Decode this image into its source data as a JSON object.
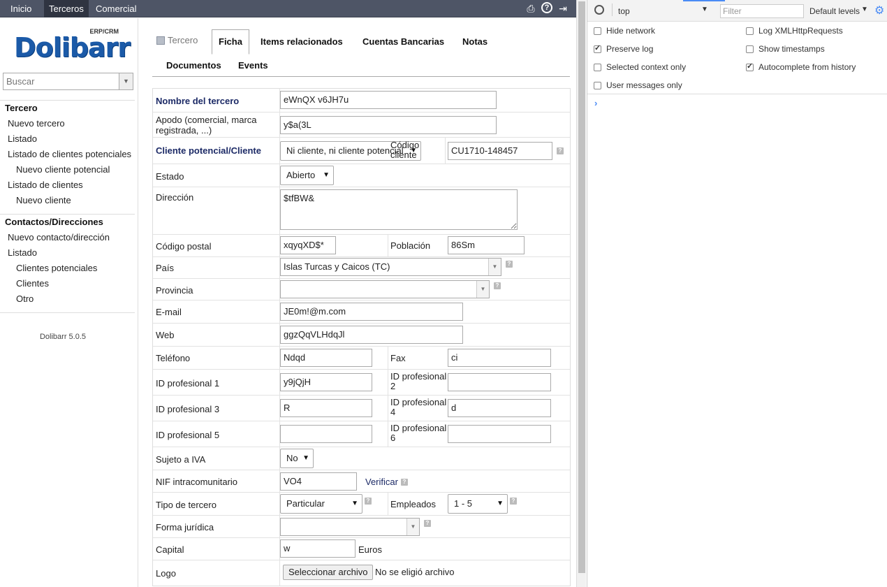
{
  "topbar": {
    "nav": [
      "Inicio",
      "Terceros",
      "Comercial"
    ],
    "active": "Terceros",
    "icons": [
      "print-icon",
      "help-icon",
      "logout-icon"
    ]
  },
  "leftbar": {
    "logo_small": "ERP/CRM",
    "logo_big": "Dolibarr",
    "search_placeholder": "Buscar",
    "menu1": {
      "title": "Tercero",
      "items": [
        "Nuevo tercero",
        "Listado",
        "Listado de clientes potenciales",
        "Nuevo cliente potencial",
        "Listado de clientes",
        "Nuevo cliente"
      ]
    },
    "menu2": {
      "title": "Contactos/Direcciones",
      "items": [
        "Nuevo contacto/dirección",
        "Listado",
        "Clientes potenciales",
        "Clientes",
        "Otro"
      ]
    },
    "version": "Dolibarr 5.0.5"
  },
  "tabs": {
    "tercero": "Tercero",
    "ficha": "Ficha",
    "items": "Items relacionados",
    "cuentas": "Cuentas Bancarias",
    "notas": "Notas",
    "documentos": "Documentos",
    "events": "Events"
  },
  "form": {
    "nombre_label": "Nombre del tercero",
    "nombre_value": "eWnQX v6JH7u",
    "apodo_label_1": "Apodo (comercial, marca",
    "apodo_label_2": "registrada, ...)",
    "apodo_value": "y$a(3L",
    "cliente_label": "Cliente potencial/Cliente",
    "cliente_value": "Ni cliente, ni cliente potencial",
    "codigo_cliente_label_1": "Código",
    "codigo_cliente_label_2": "cliente",
    "codigo_cliente_value": "CU1710-148457",
    "estado_label": "Estado",
    "estado_value": "Abierto",
    "direccion_label": "Dirección",
    "direccion_value": "$tfBW&",
    "cp_label": "Código postal",
    "cp_value": "xqyqXD$*",
    "poblacion_label": "Población",
    "poblacion_value": "86Sm",
    "pais_label": "País",
    "pais_value": "Islas Turcas y Caicos (TC)",
    "provincia_label": "Provincia",
    "provincia_value": "",
    "email_label": "E-mail",
    "email_value": "JE0m!@m.com",
    "web_label": "Web",
    "web_value": "ggzQqVLHdqJl",
    "telefono_label": "Teléfono",
    "telefono_value": "Ndqd",
    "fax_label": "Fax",
    "fax_value": "ci",
    "idprof1_label": "ID profesional 1",
    "idprof1_value": "y9jQjH",
    "idprof2_label_1": "ID profesional",
    "idprof2_label_2": "2",
    "idprof2_value": "",
    "idprof3_label": "ID profesional 3",
    "idprof3_value": "R",
    "idprof4_label_1": "ID profesional",
    "idprof4_label_2": "4",
    "idprof4_value": "d",
    "idprof5_label": "ID profesional 5",
    "idprof5_value": "",
    "idprof6_label_1": "ID profesional",
    "idprof6_label_2": "6",
    "idprof6_value": "",
    "iva_label": "Sujeto a IVA",
    "iva_value": "No",
    "nif_label": "NIF intracomunitario",
    "nif_value": "VO4",
    "verificar": "Verificar",
    "tipo_label": "Tipo de tercero",
    "tipo_value": "Particular",
    "empleados_label": "Empleados",
    "empleados_value": "1 - 5",
    "forma_label": "Forma jurídica",
    "forma_value": "",
    "capital_label": "Capital",
    "capital_value": "w",
    "capital_unit": "Euros",
    "logo_label": "Logo",
    "file_button": "Seleccionar archivo",
    "file_status": "No se eligió archivo"
  },
  "devtools": {
    "context": "top",
    "filter_placeholder": "Filter",
    "levels": "Default levels",
    "options_left": [
      {
        "label": "Hide network",
        "checked": false
      },
      {
        "label": "Preserve log",
        "checked": true
      },
      {
        "label": "Selected context only",
        "checked": false
      },
      {
        "label": "User messages only",
        "checked": false
      }
    ],
    "options_right": [
      {
        "label": "Log XMLHttpRequests",
        "checked": false
      },
      {
        "label": "Show timestamps",
        "checked": false
      },
      {
        "label": "Autocomplete from history",
        "checked": true
      }
    ],
    "prompt": "›"
  }
}
